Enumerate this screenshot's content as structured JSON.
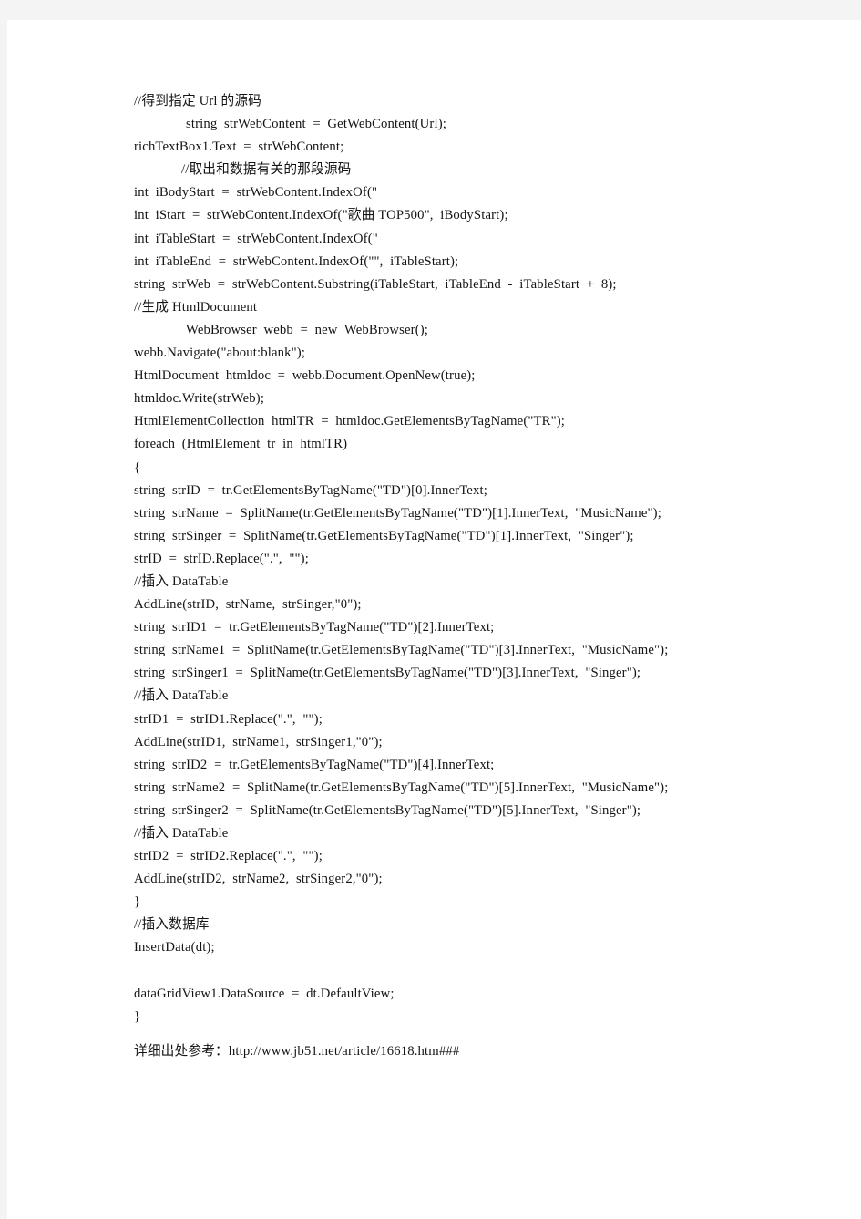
{
  "page": {
    "background_color": "#ffffff",
    "margin_color": "#f4f4f4",
    "text_color": "#141414"
  },
  "document": {
    "type": "code-listing",
    "language": "csharp",
    "lines": [
      {
        "text": "//得到指定 Url 的源码",
        "indent": 0
      },
      {
        "text": "string  strWebContent  =  GetWebContent(Url);",
        "indent": 1
      },
      {
        "text": "richTextBox1.Text  =  strWebContent;",
        "indent": 0
      },
      {
        "text": "//取出和数据有关的那段源码",
        "indent": 2
      },
      {
        "text": "int  iBodyStart  =  strWebContent.IndexOf(\"",
        "indent": 0
      },
      {
        "text": "int  iStart  =  strWebContent.IndexOf(\"歌曲 TOP500\",  iBodyStart);",
        "indent": 0
      },
      {
        "text": "int  iTableStart  =  strWebContent.IndexOf(\"",
        "indent": 0
      },
      {
        "text": "int  iTableEnd  =  strWebContent.IndexOf(\"\",  iTableStart);",
        "indent": 0
      },
      {
        "text": "string  strWeb  =  strWebContent.Substring(iTableStart,  iTableEnd  -  iTableStart  +  8);",
        "indent": 0
      },
      {
        "text": "//生成 HtmlDocument",
        "indent": 0
      },
      {
        "text": "WebBrowser  webb  =  new  WebBrowser();",
        "indent": 1
      },
      {
        "text": "webb.Navigate(\"about:blank\");",
        "indent": 0
      },
      {
        "text": "HtmlDocument  htmldoc  =  webb.Document.OpenNew(true);",
        "indent": 0
      },
      {
        "text": "htmldoc.Write(strWeb);",
        "indent": 0
      },
      {
        "text": "HtmlElementCollection  htmlTR  =  htmldoc.GetElementsByTagName(\"TR\");",
        "indent": 0
      },
      {
        "text": "foreach  (HtmlElement  tr  in  htmlTR)",
        "indent": 0
      },
      {
        "text": "{",
        "indent": 0
      },
      {
        "text": "string  strID  =  tr.GetElementsByTagName(\"TD\")[0].InnerText;",
        "indent": 0
      },
      {
        "text": "string  strName  =  SplitName(tr.GetElementsByTagName(\"TD\")[1].InnerText,  \"MusicName\");",
        "indent": 0
      },
      {
        "text": "string  strSinger  =  SplitName(tr.GetElementsByTagName(\"TD\")[1].InnerText,  \"Singer\");",
        "indent": 0
      },
      {
        "text": "strID  =  strID.Replace(\".\",  \"\");",
        "indent": 0
      },
      {
        "text": "//插入 DataTable",
        "indent": 0
      },
      {
        "text": "AddLine(strID,  strName,  strSinger,\"0\");",
        "indent": 0
      },
      {
        "text": "string  strID1  =  tr.GetElementsByTagName(\"TD\")[2].InnerText;",
        "indent": 0
      },
      {
        "text": "string  strName1  =  SplitName(tr.GetElementsByTagName(\"TD\")[3].InnerText,  \"MusicName\");",
        "indent": 0
      },
      {
        "text": "string  strSinger1  =  SplitName(tr.GetElementsByTagName(\"TD\")[3].InnerText,  \"Singer\");",
        "indent": 0
      },
      {
        "text": "//插入 DataTable",
        "indent": 0
      },
      {
        "text": "strID1  =  strID1.Replace(\".\",  \"\");",
        "indent": 0
      },
      {
        "text": "AddLine(strID1,  strName1,  strSinger1,\"0\");",
        "indent": 0
      },
      {
        "text": "string  strID2  =  tr.GetElementsByTagName(\"TD\")[4].InnerText;",
        "indent": 0
      },
      {
        "text": "string  strName2  =  SplitName(tr.GetElementsByTagName(\"TD\")[5].InnerText,  \"MusicName\");",
        "indent": 0
      },
      {
        "text": "string  strSinger2  =  SplitName(tr.GetElementsByTagName(\"TD\")[5].InnerText,  \"Singer\");",
        "indent": 0
      },
      {
        "text": "//插入 DataTable",
        "indent": 0
      },
      {
        "text": "strID2  =  strID2.Replace(\".\",  \"\");",
        "indent": 0
      },
      {
        "text": "AddLine(strID2,  strName2,  strSinger2,\"0\");",
        "indent": 0
      },
      {
        "text": "}",
        "indent": 0
      },
      {
        "text": "//插入数据库",
        "indent": 0
      },
      {
        "text": "InsertData(dt);",
        "indent": 0
      },
      {
        "text": "",
        "indent": 0
      },
      {
        "text": "dataGridView1.DataSource  =  dt.DefaultView;",
        "indent": 0
      },
      {
        "text": "}",
        "indent": 0
      }
    ],
    "footer": {
      "text": "详细出处参考：http://www.jb51.net/article/16618.htm###"
    }
  }
}
